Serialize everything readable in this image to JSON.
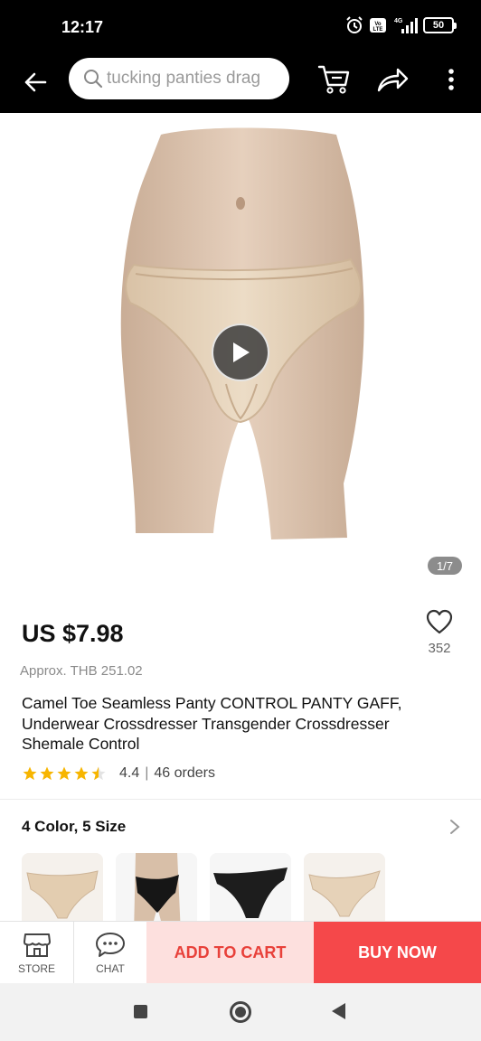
{
  "status_bar": {
    "time": "12:17",
    "network": "4G",
    "volte": "Vo LTE",
    "battery": "50",
    "icons": [
      "alarm-icon",
      "volte-icon",
      "signal-icon",
      "battery-icon"
    ]
  },
  "header": {
    "search_text": "tucking panties drag",
    "icons": [
      "back-arrow-icon",
      "search-icon",
      "cart-icon",
      "share-icon",
      "more-vertical-icon"
    ]
  },
  "gallery": {
    "page_indicator": "1/7",
    "has_video": true
  },
  "product": {
    "price": "US $7.98",
    "approx_price": "Approx. THB 251.02",
    "title": "Camel Toe Seamless Panty CONTROL PANTY GAFF, Underwear Crossdresser Transgender Crossdresser Shemale Control",
    "wish_count": "352",
    "rating": "4.4",
    "rating_stars": 4.4,
    "orders": "46 orders"
  },
  "variants": {
    "heading": "4 Color, 5 Size",
    "swatches": [
      "nude",
      "black-model",
      "black",
      "nude-flat"
    ]
  },
  "actions": {
    "store_label": "STORE",
    "chat_label": "CHAT",
    "add_to_cart_label": "ADD TO CART",
    "buy_now_label": "BUY NOW"
  },
  "colors": {
    "accent": "#f5484a",
    "cart_bg": "#fde0de",
    "cart_text": "#e8413a",
    "star": "#f7b500"
  }
}
